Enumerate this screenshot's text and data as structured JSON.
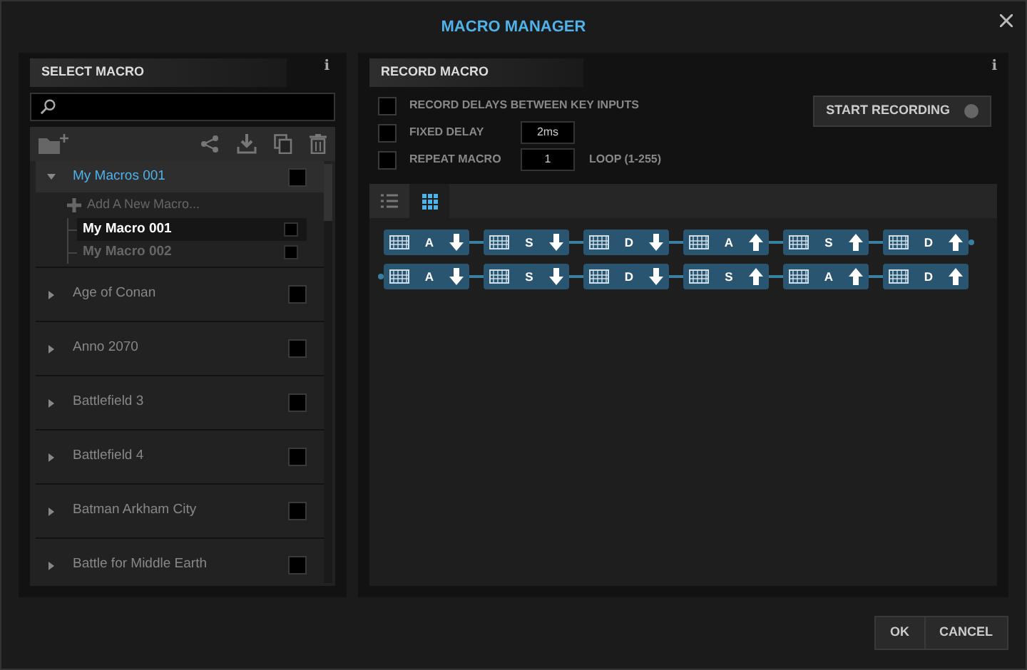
{
  "window": {
    "title": "MACRO MANAGER"
  },
  "select_macro": {
    "title": "SELECT MACRO",
    "info": "i",
    "groups": [
      {
        "name": "My Macros 001",
        "expanded": true,
        "checked": false,
        "add_label": "Add A New Macro...",
        "children": [
          {
            "name": "My Macro 001",
            "selected": true,
            "checked": false
          },
          {
            "name": "My Macro 002",
            "selected": false,
            "checked": false
          }
        ]
      },
      {
        "name": "Age of Conan",
        "expanded": false,
        "checked": false
      },
      {
        "name": "Anno 2070",
        "expanded": false,
        "checked": false
      },
      {
        "name": "Battlefield 3",
        "expanded": false,
        "checked": false
      },
      {
        "name": "Battlefield 4",
        "expanded": false,
        "checked": false
      },
      {
        "name": "Batman Arkham City",
        "expanded": false,
        "checked": false
      },
      {
        "name": "Battle for Middle Earth",
        "expanded": false,
        "checked": false
      }
    ]
  },
  "record_macro": {
    "title": "RECORD MACRO",
    "info": "i",
    "options": [
      {
        "label": "RECORD DELAYS BETWEEN KEY INPUTS",
        "checked": false
      },
      {
        "label": "FIXED DELAY",
        "checked": false,
        "value": "2ms"
      },
      {
        "label": "REPEAT MACRO",
        "checked": false,
        "value": "1",
        "note": "LOOP (1-255)"
      }
    ],
    "start_button": "START RECORDING",
    "view_tabs": [
      {
        "kind": "list",
        "selected": false
      },
      {
        "kind": "grid",
        "selected": true
      }
    ],
    "step_rows": [
      [
        {
          "key": "A",
          "key_up": false
        },
        {
          "key": "S",
          "key_up": false
        },
        {
          "key": "D",
          "key_up": false
        },
        {
          "key": "A",
          "key_up": true
        },
        {
          "key": "S",
          "key_up": true
        },
        {
          "key": "D",
          "key_up": true
        }
      ],
      [
        {
          "key": "A",
          "key_up": false
        },
        {
          "key": "S",
          "key_up": false
        },
        {
          "key": "D",
          "key_up": false
        },
        {
          "key": "S",
          "key_up": true
        },
        {
          "key": "A",
          "key_up": true
        },
        {
          "key": "D",
          "key_up": true
        }
      ]
    ]
  },
  "buttons": [
    "OK",
    "CANCEL"
  ]
}
